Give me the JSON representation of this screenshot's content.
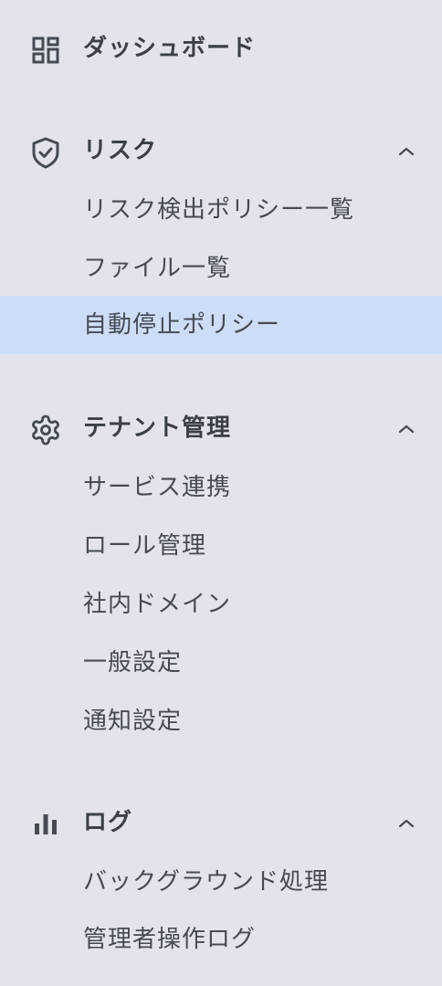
{
  "sidebar": {
    "dashboard": {
      "label": "ダッシュボード",
      "icon": "dashboard-icon"
    },
    "risk": {
      "label": "リスク",
      "icon": "shield-check-icon",
      "expanded": true,
      "items": [
        {
          "label": "リスク検出ポリシー一覧",
          "active": false
        },
        {
          "label": "ファイル一覧",
          "active": false
        },
        {
          "label": "自動停止ポリシー",
          "active": true
        }
      ]
    },
    "tenant": {
      "label": "テナント管理",
      "icon": "gear-icon",
      "expanded": true,
      "items": [
        {
          "label": "サービス連携"
        },
        {
          "label": "ロール管理"
        },
        {
          "label": "社内ドメイン"
        },
        {
          "label": "一般設定"
        },
        {
          "label": "通知設定"
        }
      ]
    },
    "log": {
      "label": "ログ",
      "icon": "bar-chart-icon",
      "expanded": true,
      "items": [
        {
          "label": "バックグラウンド処理"
        },
        {
          "label": "管理者操作ログ"
        }
      ]
    }
  },
  "colors": {
    "background": "#e3e4eb",
    "active_background": "#cdddf8",
    "text": "#3c4049",
    "icon": "#454a54"
  }
}
